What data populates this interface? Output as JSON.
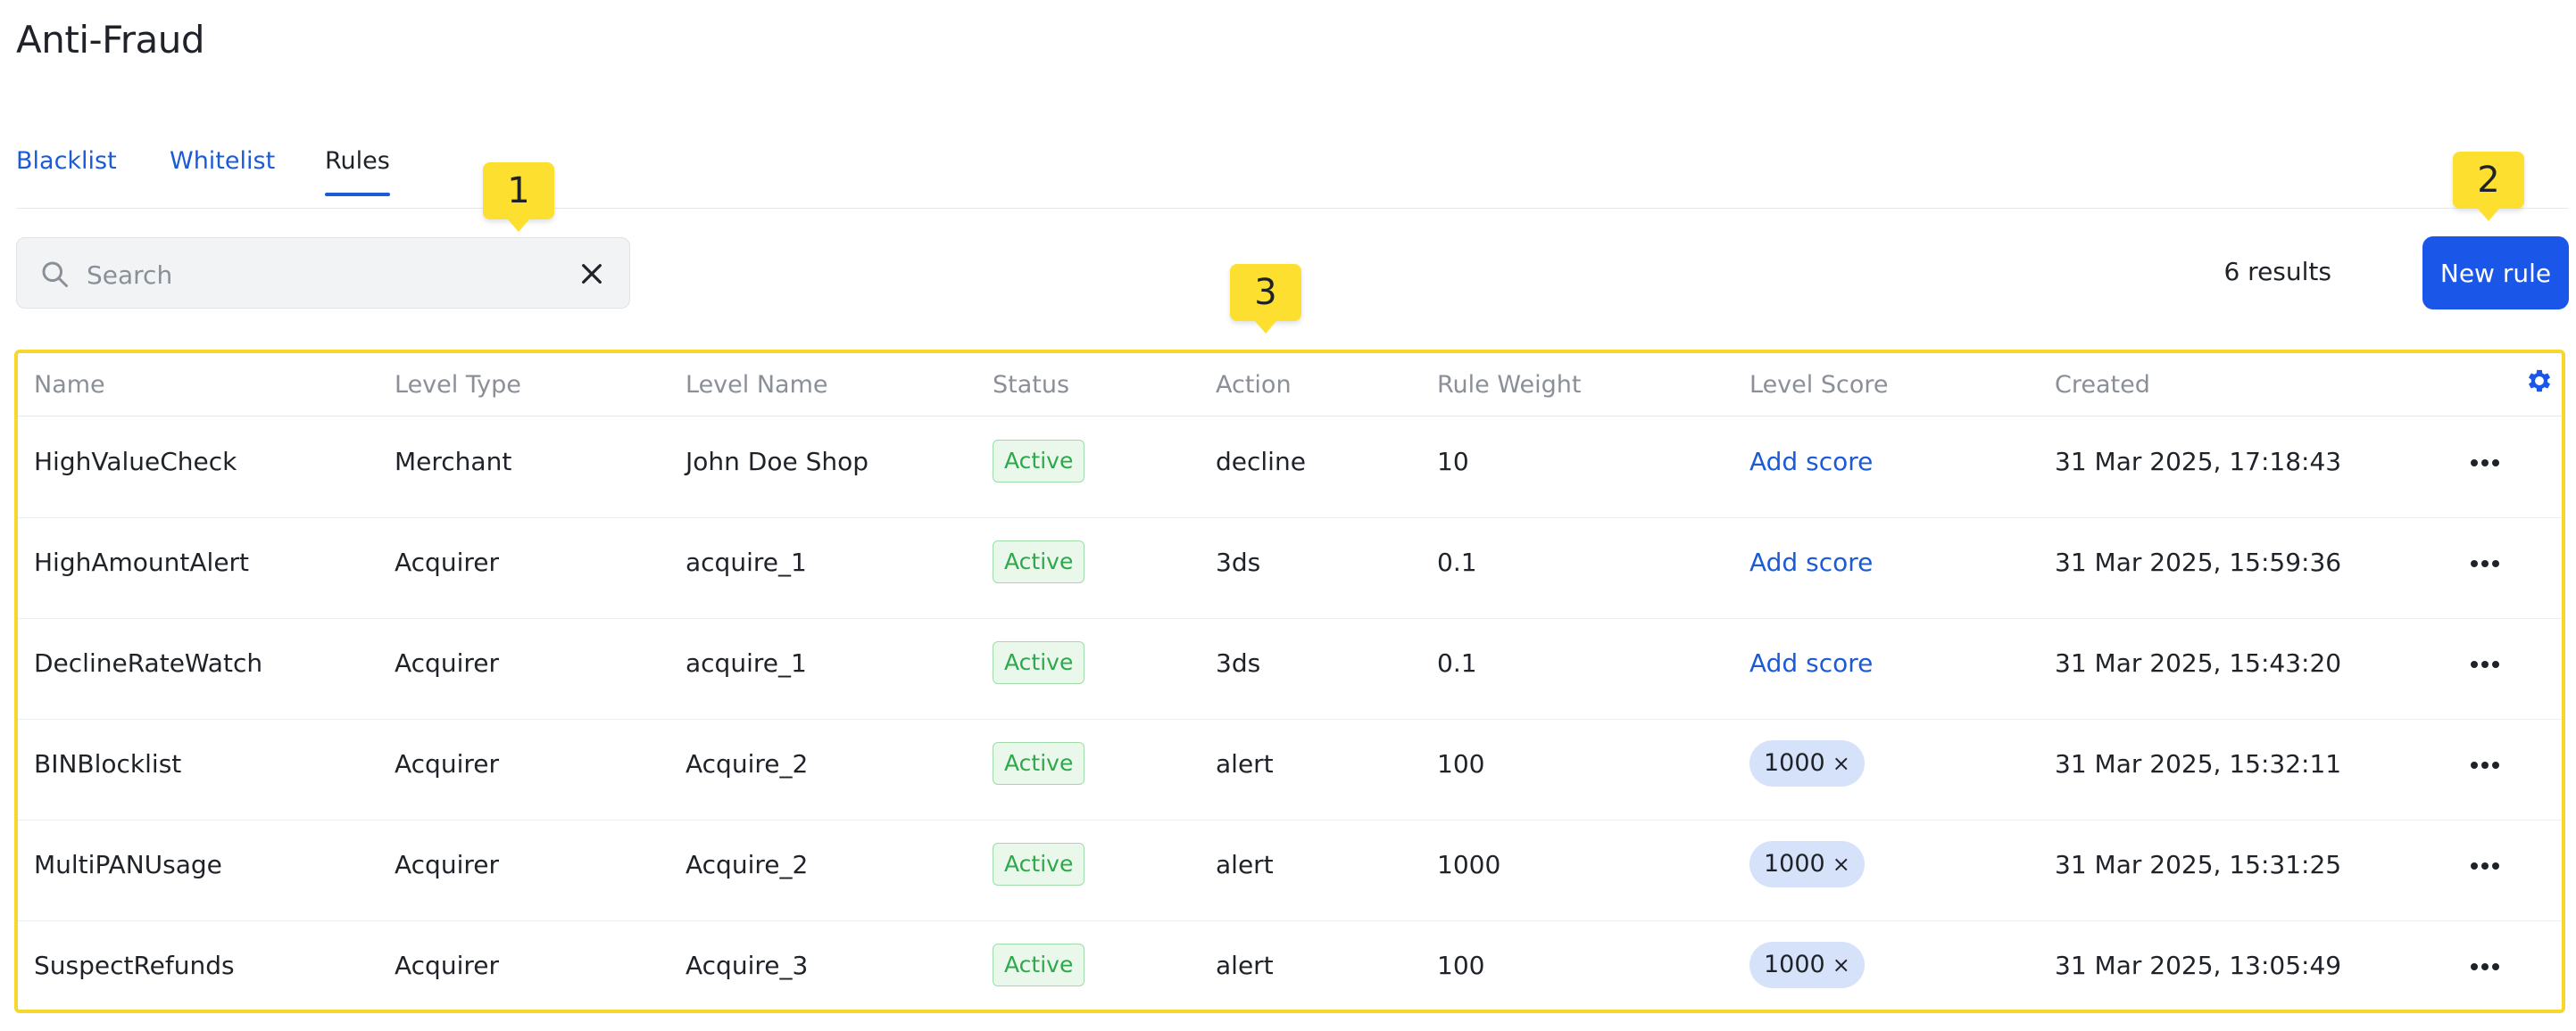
{
  "page": {
    "title": "Anti-Fraud"
  },
  "tabs": [
    {
      "label": "Blacklist",
      "active": false
    },
    {
      "label": "Whitelist",
      "active": false
    },
    {
      "label": "Rules",
      "active": true
    }
  ],
  "search": {
    "placeholder": "Search",
    "value": ""
  },
  "results": {
    "count_label": "6 results"
  },
  "toolbar": {
    "new_rule_label": "New rule"
  },
  "callouts": {
    "one": "1",
    "two": "2",
    "three": "3"
  },
  "table": {
    "columns": [
      "Name",
      "Level Type",
      "Level Name",
      "Status",
      "Action",
      "Rule Weight",
      "Level Score",
      "Created"
    ],
    "add_score_label": "Add score",
    "remove_glyph": "×",
    "rows": [
      {
        "name": "HighValueCheck",
        "level_type": "Merchant",
        "level_name": "John Doe Shop",
        "status": "Active",
        "action": "decline",
        "rule_weight": "10",
        "level_score": "",
        "created": "31 Mar 2025, 17:18:43"
      },
      {
        "name": "HighAmountAlert",
        "level_type": "Acquirer",
        "level_name": "acquire_1",
        "status": "Active",
        "action": "3ds",
        "rule_weight": "0.1",
        "level_score": "",
        "created": "31 Mar 2025, 15:59:36"
      },
      {
        "name": "DeclineRateWatch",
        "level_type": "Acquirer",
        "level_name": "acquire_1",
        "status": "Active",
        "action": "3ds",
        "rule_weight": "0.1",
        "level_score": "",
        "created": "31 Mar 2025, 15:43:20"
      },
      {
        "name": "BINBlocklist",
        "level_type": "Acquirer",
        "level_name": "Acquire_2",
        "status": "Active",
        "action": "alert",
        "rule_weight": "100",
        "level_score": "1000",
        "created": "31 Mar 2025, 15:32:11"
      },
      {
        "name": "MultiPANUsage",
        "level_type": "Acquirer",
        "level_name": "Acquire_2",
        "status": "Active",
        "action": "alert",
        "rule_weight": "1000",
        "level_score": "1000",
        "created": "31 Mar 2025, 15:31:25"
      },
      {
        "name": "SuspectRefunds",
        "level_type": "Acquirer",
        "level_name": "Acquire_3",
        "status": "Active",
        "action": "alert",
        "rule_weight": "100",
        "level_score": "1000",
        "created": "31 Mar 2025, 13:05:49"
      }
    ]
  },
  "icons": {
    "search": "search-icon",
    "clear": "close-icon",
    "settings": "gear-icon",
    "row_menu": "more-horizontal-icon"
  },
  "colors": {
    "accent": "#1a56e8",
    "link": "#1c5bd8",
    "status_active_text": "#2ea84a",
    "status_active_bg": "#eaf8ec",
    "chip_bg": "#d6e2fa",
    "callout": "#fde02f"
  }
}
